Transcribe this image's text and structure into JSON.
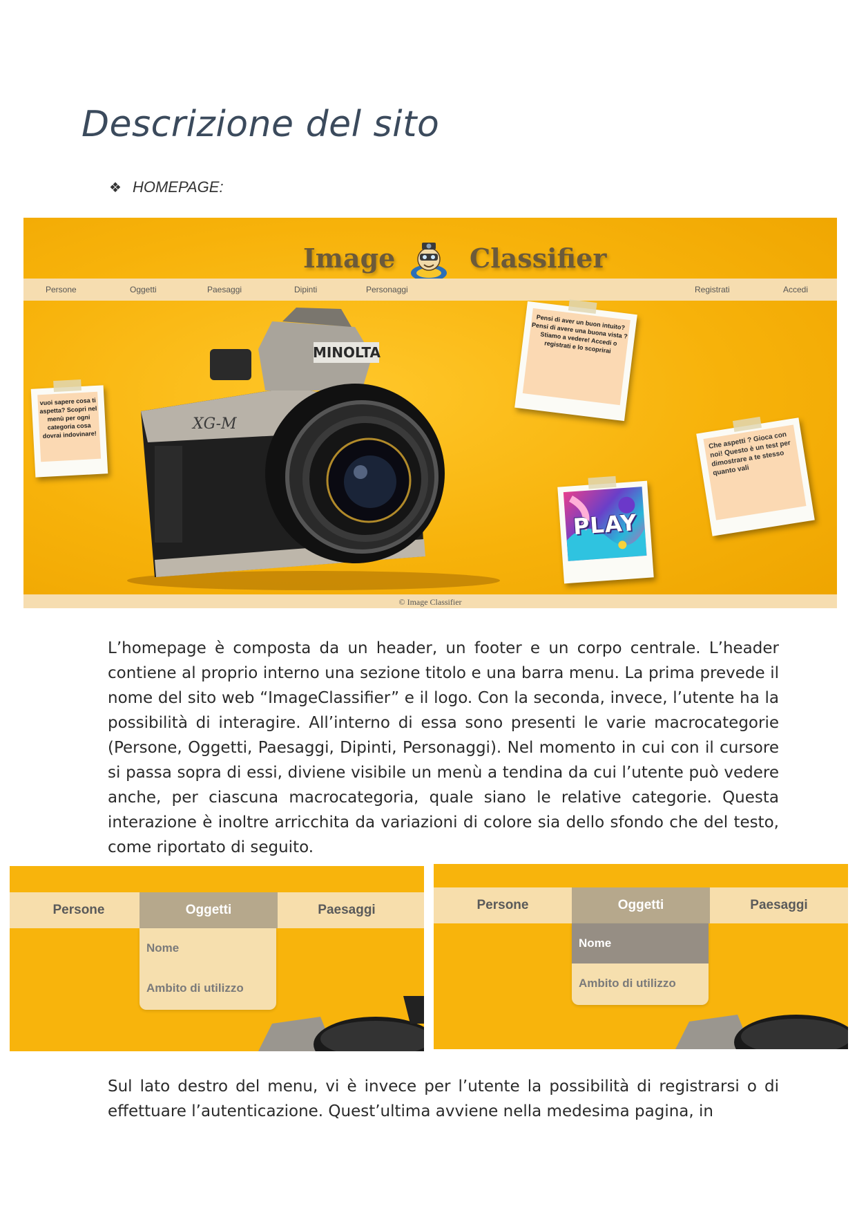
{
  "document": {
    "title": "Descrizione del sito",
    "section_bullet": "HOMEPAGE:",
    "paragraph_1": "L’homepage è composta da un header, un footer e un corpo centrale. L’header contiene al proprio interno una sezione titolo e una barra menu. La prima prevede il nome del sito web “ImageClassifier” e il logo. Con la seconda, invece, l’utente ha la possibilità di interagire. All’interno di essa sono presenti le varie macrocategorie (Persone, Oggetti, Paesaggi, Dipinti, Personaggi). Nel momento in cui con il cursore si passa sopra di essi, diviene visibile un menù a tendina da cui l’utente può vedere anche, per ciascuna macrocategoria, quale siano le relative categorie. Questa interazione è inoltre arricchita da variazioni di colore sia dello sfondo che del testo, come riportato di seguito.",
    "paragraph_2": "Sul lato destro del menu, vi è invece per l’utente la possibilità di registrarsi o di effettuare l’autenticazione. Quest’ultima avviene nella medesima pagina, in"
  },
  "homepage": {
    "title_left": "Image",
    "title_right": "Classifier",
    "nav": {
      "persone": "Persone",
      "oggetti": "Oggetti",
      "paesaggi": "Paesaggi",
      "dipinti": "Dipinti",
      "personaggi": "Personaggi",
      "registrati": "Registrati",
      "accedi": "Accedi"
    },
    "camera_brand": "MINOLTA",
    "camera_model": "XG-M",
    "note_left": "vuoi sapere cosa ti aspetta? Scopri nel menù per ogni categoria cosa dovrai indovinare!",
    "note_center": "Pensi di aver un buon intuito? Pensi di avere una buona vista ? Stiamo a vedere! Accedi o registrati e lo scoprirai",
    "note_right": "Che aspetti ? Gioca con noi! Questo è un test per dimostrare a te stesso quanto vali",
    "play_label": "PLAY",
    "footer": "© Image Classifier"
  },
  "dropdown_demo": {
    "persone": "Persone",
    "oggetti": "Oggetti",
    "paesaggi": "Paesaggi",
    "sub_nome": "Nome",
    "sub_ambito": "Ambito di utilizzo"
  },
  "colors": {
    "background_yellow": "#f8b40c",
    "menu_bar": "#f6ddb0",
    "active_tab": "#b6a88c",
    "hover_item": "#968e84",
    "title_text": "#3b4a5c"
  }
}
